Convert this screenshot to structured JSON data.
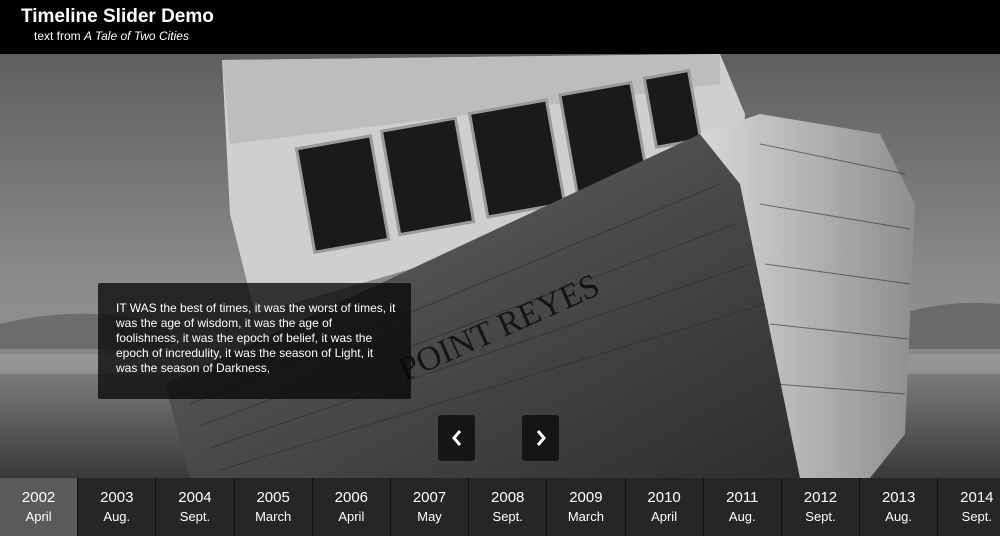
{
  "header": {
    "title": "Timeline Slider Demo",
    "subtitle_prefix": "text from ",
    "subtitle_book": "A Tale of Two Cities"
  },
  "slide": {
    "image_description": "black-and-white photo of a beached fishing boat",
    "hull_lettering": "POINT REYES",
    "caption": "IT WAS the best of times, it was the worst of times, it was the age of wisdom, it was the age of foolishness, it was the epoch of belief, it was the epoch of incredulity, it was the season of Light, it was the season of Darkness,"
  },
  "nav": {
    "prev_icon": "chevron-left-icon",
    "next_icon": "chevron-right-icon"
  },
  "timeline": {
    "active_index": 0,
    "items": [
      {
        "year": "2002",
        "month": "April"
      },
      {
        "year": "2003",
        "month": "Aug."
      },
      {
        "year": "2004",
        "month": "Sept."
      },
      {
        "year": "2005",
        "month": "March"
      },
      {
        "year": "2006",
        "month": "April"
      },
      {
        "year": "2007",
        "month": "May"
      },
      {
        "year": "2008",
        "month": "Sept."
      },
      {
        "year": "2009",
        "month": "March"
      },
      {
        "year": "2010",
        "month": "April"
      },
      {
        "year": "2011",
        "month": "Aug."
      },
      {
        "year": "2012",
        "month": "Sept."
      },
      {
        "year": "2013",
        "month": "Aug."
      },
      {
        "year": "2014",
        "month": "Sept."
      }
    ]
  },
  "colors": {
    "header_bg": "#000000",
    "timeline_bg": "#262626",
    "timeline_active_bg": "#5a5a5a"
  }
}
